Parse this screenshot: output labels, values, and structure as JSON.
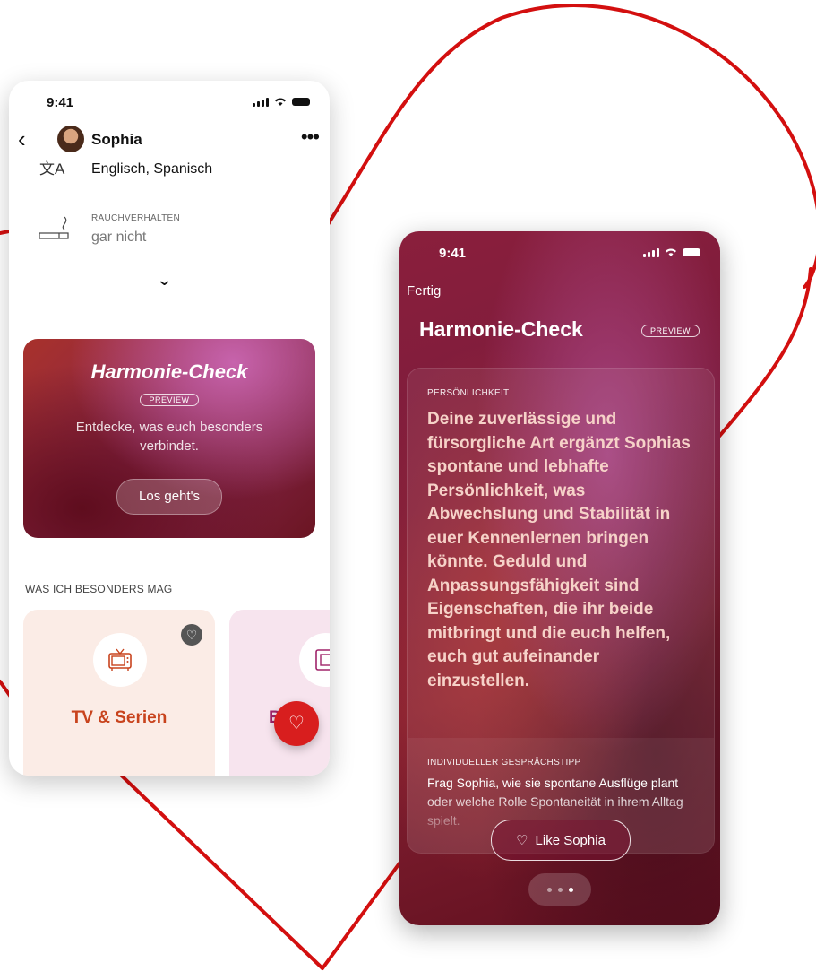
{
  "colors": {
    "heart_outline": "#d30f0f",
    "accent_red": "#d81e1e",
    "tv_title": "#c8431d",
    "second_title": "#a0246a"
  },
  "profile_screen": {
    "status_time": "9:41",
    "header": {
      "name": "Sophia"
    },
    "languages": {
      "icon": "language-icon",
      "value": "Englisch, Spanisch"
    },
    "smoking": {
      "icon": "cigarette-icon",
      "label": "RAUCHVERHALTEN",
      "value": "gar nicht"
    },
    "harmony_card": {
      "title": "Harmonie-Check",
      "badge": "PREVIEW",
      "description": "Entdecke, was euch besonders verbindet.",
      "button": "Los geht's"
    },
    "likes": {
      "label": "WAS ICH BESONDERS MAG",
      "tiles": [
        {
          "title": "TV & Serien",
          "icon": "tv-icon"
        },
        {
          "title": "Bu",
          "icon": "frame-icon"
        }
      ]
    }
  },
  "harmony_screen": {
    "status_time": "9:41",
    "done": "Fertig",
    "title": "Harmonie-Check",
    "badge": "PREVIEW",
    "personality": {
      "label": "PERSÖNLICHKEIT",
      "text": "Deine zuverlässige und fürsorgliche Art ergänzt Sophias spontane und lebhafte Persönlichkeit, was Abwechslung und Stabilität in euer Kennenlernen bringen könnte. Geduld und Anpassungsfähigkeit sind Eigenschaften, die ihr beide mitbringt und die euch helfen, euch gut aufeinander einzustellen."
    },
    "tip": {
      "label": "INDIVIDUELLER GESPRÄCHSTIPP",
      "text": "Frag Sophia, wie sie spontane Ausflüge plant oder welche Rolle Spontaneität in ihrem Alltag spielt."
    },
    "like_button": "Like Sophia",
    "pager": {
      "total": 3,
      "active": 3
    }
  }
}
